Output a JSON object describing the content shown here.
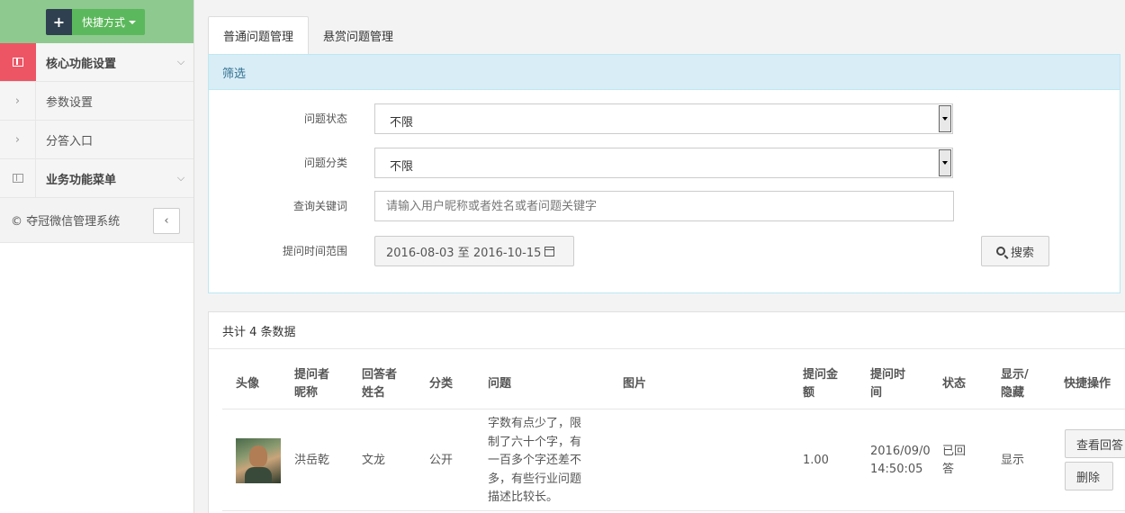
{
  "sidebar": {
    "quick_label": "快捷方式",
    "items": [
      {
        "label": "核心功能设置"
      },
      {
        "label": "参数设置"
      },
      {
        "label": "分答入口"
      },
      {
        "label": "业务功能菜单"
      }
    ],
    "footer": "© 夺冠微信管理系统"
  },
  "tabs": [
    {
      "label": "普通问题管理",
      "active": true
    },
    {
      "label": "悬赏问题管理",
      "active": false
    }
  ],
  "filter": {
    "title": "筛选",
    "status_label": "问题状态",
    "status_value": "不限",
    "category_label": "问题分类",
    "category_value": "不限",
    "keyword_label": "查询关键词",
    "keyword_placeholder": "请输入用户昵称或者姓名或者问题关键字",
    "date_label": "提问时间范围",
    "date_range": "2016-08-03 至 2016-10-15",
    "search_label": "搜索"
  },
  "results": {
    "summary": "共计 4 条数据",
    "columns": [
      "头像",
      "提问者\n昵称",
      "回答者\n姓名",
      "分类",
      "问题",
      "图片",
      "提问金\n额",
      "提问时\n间",
      "状态",
      "显示/\n隐藏",
      "快捷操作"
    ],
    "rows": [
      {
        "asker": "洪岳乾",
        "answerer": "文龙",
        "category": "公开",
        "question": "字数有点少了，限\n制了六十个字，有\n一百多个字还差不\n多，有些行业问题\n描述比较长。",
        "amount": "1.00",
        "time": "2016/09/0\n14:50:05",
        "status": "已回\n答",
        "visibility": "显示",
        "action_view": "查看回答",
        "action_delete": "删除"
      }
    ]
  },
  "colors": {
    "sidebar_top": "#8ec990",
    "active_red": "#ed5565",
    "panel_head": "#d9edf7",
    "accent_green": "#5cb85c"
  }
}
